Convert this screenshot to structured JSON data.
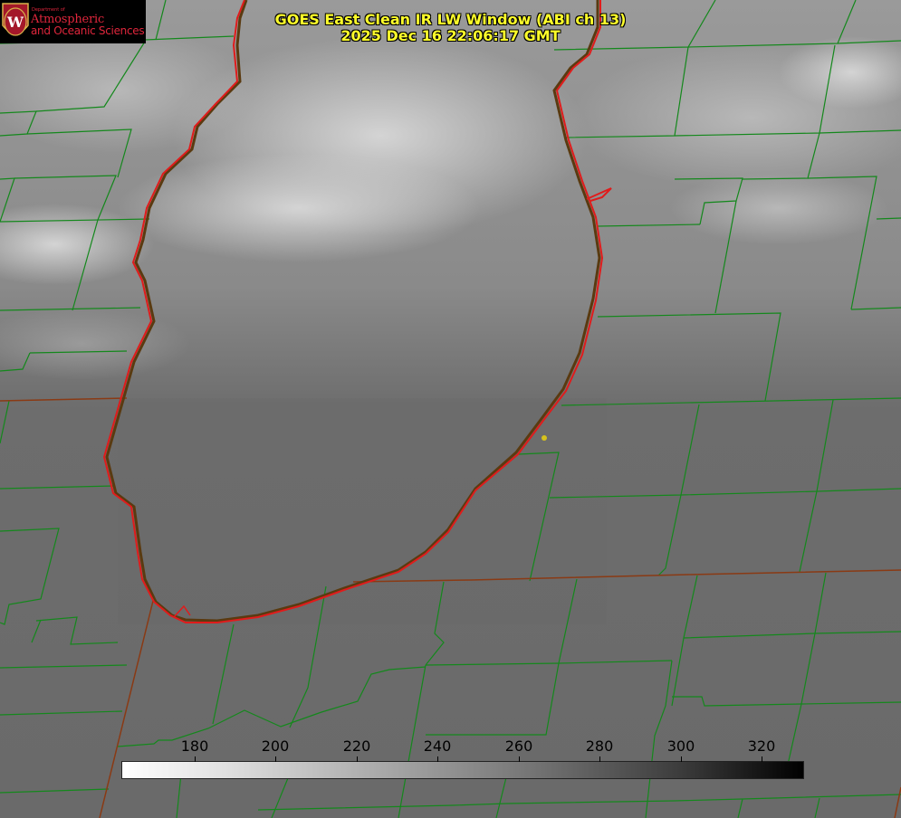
{
  "title": {
    "line1": "GOES East Clean IR LW Window (ABI ch 13)",
    "line2": "2025 Dec 16 22:06:17 GMT"
  },
  "logo": {
    "dept": "Department of",
    "line1": "Atmospheric",
    "line2": "and Oceanic Sciences",
    "emblem_letter": "W"
  },
  "colorbar": {
    "ticks": [
      "180",
      "200",
      "220",
      "240",
      "260",
      "280",
      "300",
      "320"
    ]
  },
  "colors": {
    "lake_outline": "#e01b1b",
    "county_lines": "#14881c",
    "state_lines": "#8a3a14",
    "title_text": "#ffff2a",
    "logo_text": "#e0263c",
    "site_marker": "#d6c21c"
  }
}
